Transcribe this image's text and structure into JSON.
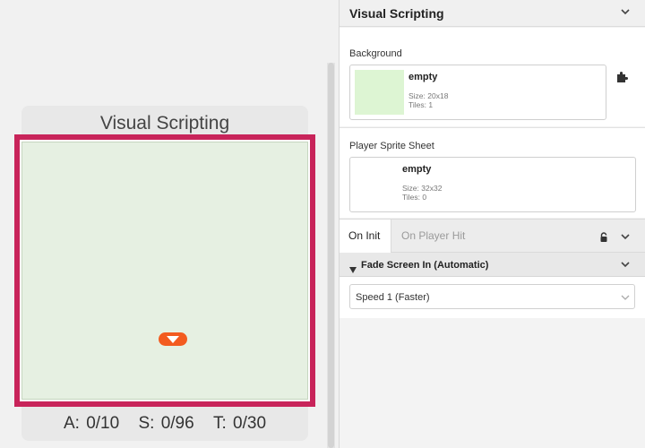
{
  "scene": {
    "title": "Visual Scripting",
    "stats": {
      "actors": "A: 0/10",
      "sprites": "S: 0/96",
      "triggers": "T: 0/30"
    }
  },
  "editor": {
    "title": "Visual Scripting",
    "background": {
      "label": "Background",
      "name": "empty",
      "size": "Size:  20x18",
      "tiles": "Tiles:  1"
    },
    "player_sprite": {
      "label": "Player Sprite Sheet",
      "name": "empty",
      "size": "Size:  32x32",
      "tiles": "Tiles:  0"
    },
    "tabs": [
      {
        "label": "On Init",
        "active": true
      },
      {
        "label": "On Player Hit",
        "active": false
      }
    ],
    "event": {
      "title": "Fade Screen In (Automatic)",
      "speed_value": "Speed 1 (Faster)"
    }
  },
  "colors": {
    "scene_border": "#c8245a",
    "scene_fill": "#e6f0e2",
    "trigger_marker": "#f35b1f",
    "bg_thumb": "#ddf5d3"
  },
  "icons": [
    "collapse-chevron-icon",
    "puzzle-icon",
    "lock-icon",
    "trigger-arrow-icon",
    "select-chevron-icon",
    "triangle-collapse-icon"
  ]
}
